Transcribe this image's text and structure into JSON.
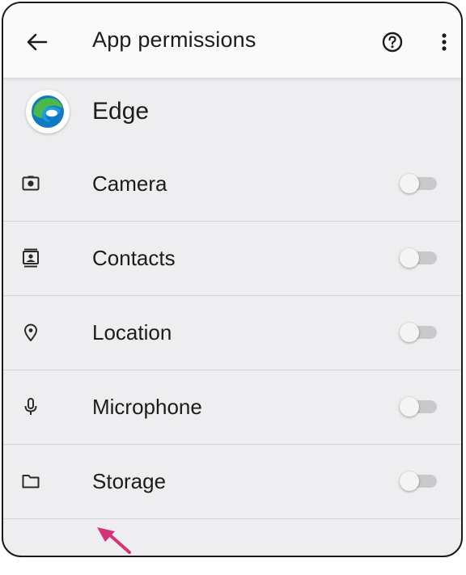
{
  "appbar": {
    "title": "App permissions",
    "back_icon": "arrow-left-icon",
    "help_icon": "help-circle-icon",
    "more_icon": "more-vert-icon"
  },
  "app": {
    "name": "Edge",
    "logo_icon": "edge-logo"
  },
  "permissions": [
    {
      "label": "Camera",
      "icon": "camera-icon",
      "enabled": false
    },
    {
      "label": "Contacts",
      "icon": "contacts-icon",
      "enabled": false
    },
    {
      "label": "Location",
      "icon": "location-pin-icon",
      "enabled": false
    },
    {
      "label": "Microphone",
      "icon": "microphone-icon",
      "enabled": false
    },
    {
      "label": "Storage",
      "icon": "folder-icon",
      "enabled": false
    }
  ],
  "annotation": {
    "arrow_color": "#d6327a"
  },
  "colors": {
    "screen_bg": "#eeeef0",
    "appbar_bg": "#fafafa",
    "edge_blue": "#0f7ac4",
    "edge_green": "#4ab84a"
  }
}
